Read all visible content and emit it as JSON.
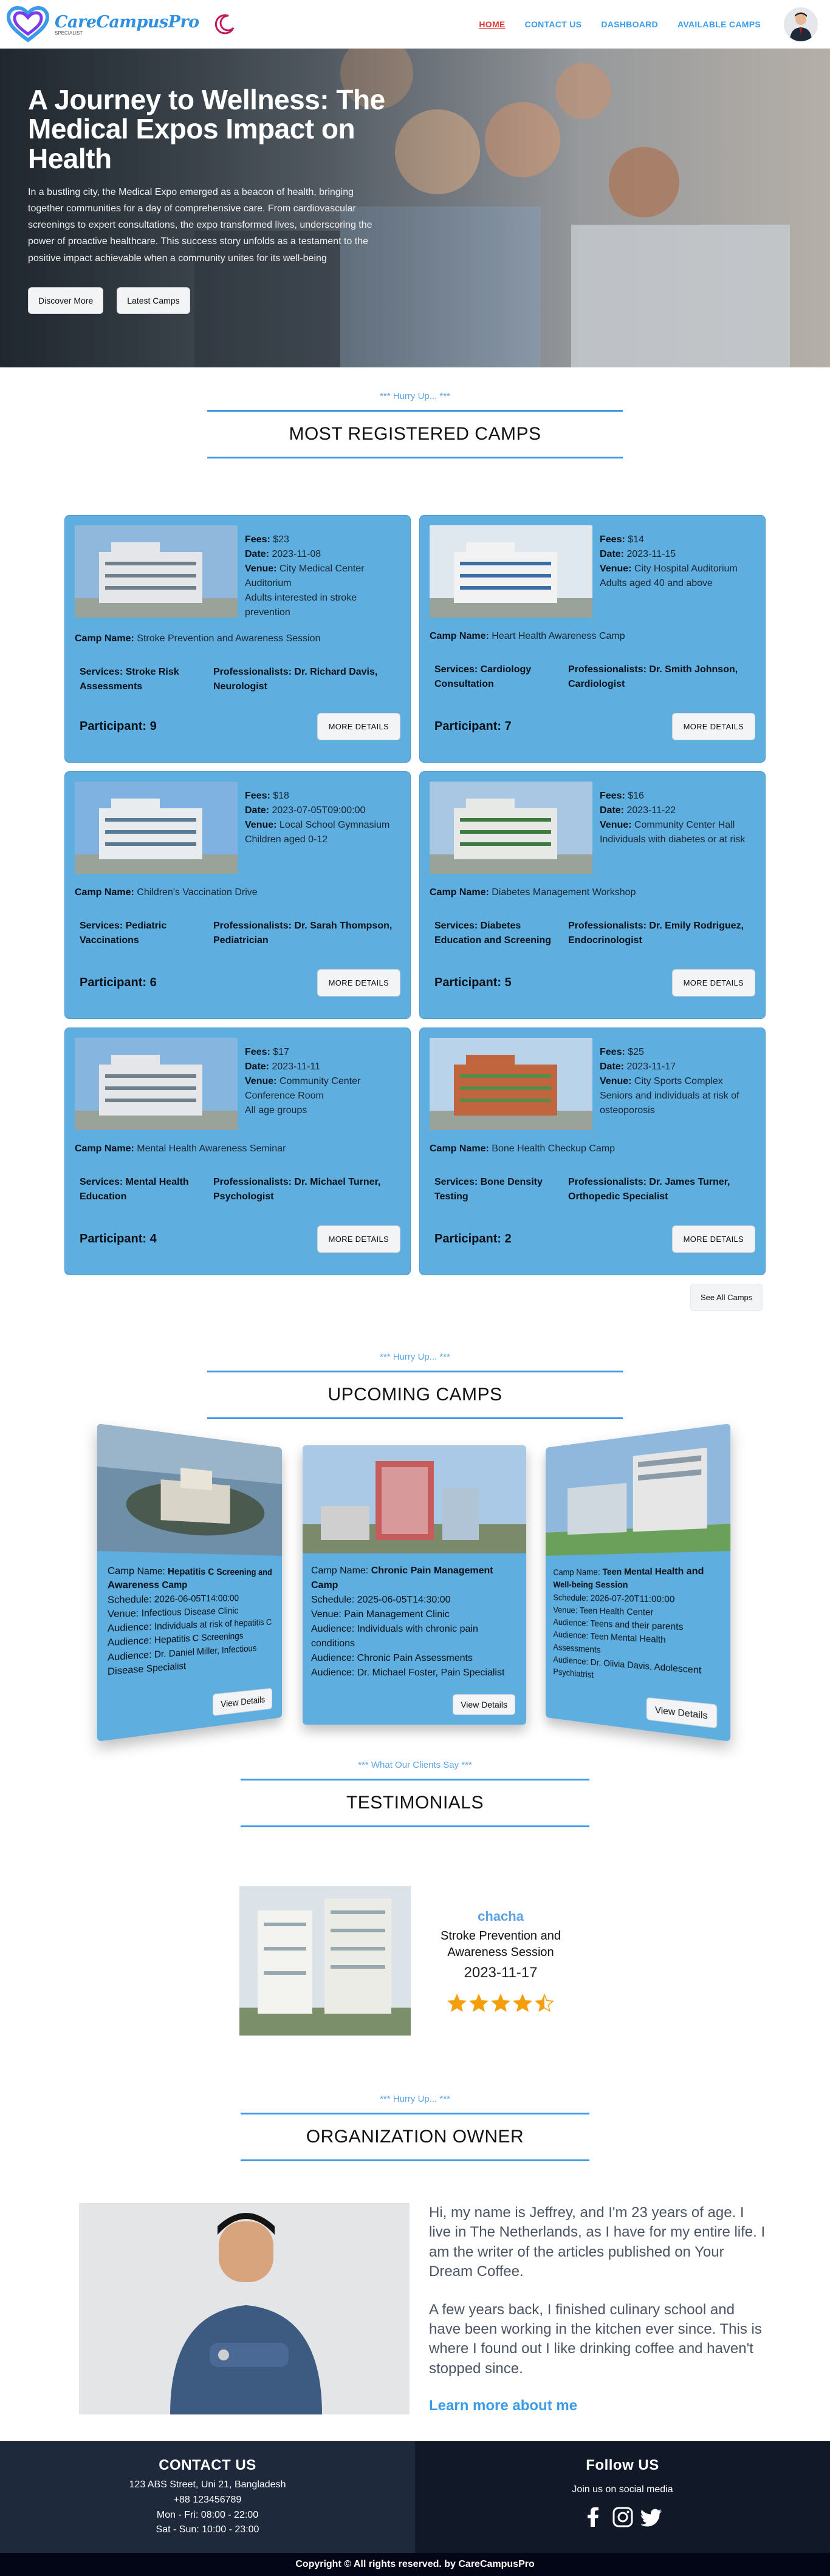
{
  "brand": {
    "name": "CareCampusPro",
    "subtitle": "SPECIALIST"
  },
  "nav": {
    "links": [
      {
        "label": "HOME",
        "active": true
      },
      {
        "label": "CONTACT US",
        "active": false
      },
      {
        "label": "DASHBOARD",
        "active": false
      },
      {
        "label": "AVAILABLE CAMPS",
        "active": false
      }
    ]
  },
  "hero": {
    "title": "A Journey to Wellness: The Medical Expos Impact on Health",
    "text": "In a bustling city, the Medical Expo emerged as a beacon of health, bringing together communities for a day of comprehensive care. From cardiovascular screenings to expert consultations, the expo transformed lives, underscoring the power of proactive healthcare. This success story unfolds as a testament to the positive impact achievable when a community unites for its well-being",
    "btn_discover": "Discover More",
    "btn_latest": "Latest Camps"
  },
  "registered": {
    "subtitle": "*** Hurry Up... ***",
    "title": "MOST REGISTERED CAMPS",
    "labels": {
      "fees": "Fees:",
      "date": "Date:",
      "venue": "Venue:",
      "camp_name": "Camp Name:",
      "services": "Services:",
      "professionals": "Professionalists:",
      "participant": "Participant:",
      "more": "MORE DETAILS"
    },
    "camps": [
      {
        "fees": "$23",
        "date": "2023-11-08",
        "venue": "City Medical Center Auditorium",
        "audience": "Adults interested in stroke prevention",
        "name": "Stroke Prevention and Awareness Session",
        "services": "Stroke Risk Assessments",
        "professionals": "Dr. Richard Davis, Neurologist",
        "participants": "9"
      },
      {
        "fees": "$14",
        "date": "2023-11-15",
        "venue": "City Hospital Auditorium",
        "audience": "Adults aged 40 and above",
        "name": "Heart Health Awareness Camp",
        "services": "Cardiology Consultation",
        "professionals": "Dr. Smith Johnson, Cardiologist",
        "participants": "7"
      },
      {
        "fees": "$18",
        "date": "2023-07-05T09:00:00",
        "venue": "Local School Gymnasium",
        "audience": "Children aged 0-12",
        "name": "Children's Vaccination Drive",
        "services": "Pediatric Vaccinations",
        "professionals": "Dr. Sarah Thompson, Pediatrician",
        "participants": "6"
      },
      {
        "fees": "$16",
        "date": "2023-11-22",
        "venue": "Community Center Hall",
        "audience": "Individuals with diabetes or at risk",
        "name": "Diabetes Management Workshop",
        "services": "Diabetes Education and Screening",
        "professionals": "Dr. Emily Rodriguez, Endocrinologist",
        "participants": "5"
      },
      {
        "fees": "$17",
        "date": "2023-11-11",
        "venue": "Community Center Conference Room",
        "audience": "All age groups",
        "name": "Mental Health Awareness Seminar",
        "services": "Mental Health Education",
        "professionals": "Dr. Michael Turner, Psychologist",
        "participants": "4"
      },
      {
        "fees": "$25",
        "date": "2023-11-17",
        "venue": "City Sports Complex",
        "audience": "Seniors and individuals at risk of osteoporosis",
        "name": "Bone Health Checkup Camp",
        "services": "Bone Density Testing",
        "professionals": "Dr. James Turner, Orthopedic Specialist",
        "participants": "2"
      }
    ],
    "see_all": "See All Camps"
  },
  "upcoming": {
    "subtitle": "*** Hurry Up... ***",
    "title": "UPCOMING CAMPS",
    "labels": {
      "camp_name": "Camp Name:",
      "schedule": "Schedule:",
      "venue": "Venue:",
      "audience": "Audience:",
      "view": "View Details"
    },
    "left": {
      "name": "Hepatitis C Screening and Awareness Camp",
      "schedule": "2026-06-05T14:00:00",
      "venue": "Infectious Disease Clinic",
      "audience1": "Individuals at risk of hepatitis C",
      "audience2": "Hepatitis C Screenings",
      "audience3": "Dr. Daniel Miller, Infectious Disease Specialist"
    },
    "center": {
      "name": "Chronic Pain Management Camp",
      "schedule": "2025-06-05T14:30:00",
      "venue": "Pain Management Clinic",
      "audience1": "Individuals with chronic pain conditions",
      "audience2": "Chronic Pain Assessments",
      "audience3": "Dr. Michael Foster, Pain Specialist"
    },
    "right": {
      "name": "Teen Mental Health and Well-being Session",
      "schedule": "2026-07-20T11:00:00",
      "venue": "Teen Health Center",
      "audience1": "Teens and their parents",
      "audience2": "Teen Mental Health Assessments",
      "audience3": "Dr. Olivia Davis, Adolescent Psychiatrist"
    }
  },
  "testimonials": {
    "subtitle": "*** What Our Clients Say ***",
    "title": "TESTIMONIALS",
    "name": "chacha",
    "camp": "Stroke Prevention and Awareness Session",
    "date": "2023-11-17",
    "rating": 4.5
  },
  "owner": {
    "subtitle": "*** Hurry Up... ***",
    "title": "ORGANIZATION OWNER",
    "para1": "Hi, my name is Jeffrey, and I'm 23 years of age. I live in The Netherlands, as I have for my entire life. I am the writer of the articles published on Your Dream Coffee.",
    "para2": "A few years back, I finished culinary school and have been working in the kitchen ever since. This is where I found out I like drinking coffee and haven't stopped since.",
    "link": "Learn more about me"
  },
  "footer": {
    "contact_title": "CONTACT US",
    "address": "123 ABS Street, Uni 21, Bangladesh",
    "phone": "+88 123456789",
    "hours1": "Mon - Fri: 08:00 - 22:00",
    "hours2": "Sat - Sun: 10:00 - 23:00",
    "follow_title": "Follow US",
    "follow_text": "Join us on social media",
    "copyright": "Copyright © All rights reserved. by CareCampusPro"
  },
  "colors": {
    "accent": "#3b9be8",
    "card": "#5eaee0",
    "active": "#e03131",
    "footer_left": "#1e293b",
    "footer_right": "#111827",
    "star": "#f59e0b"
  }
}
